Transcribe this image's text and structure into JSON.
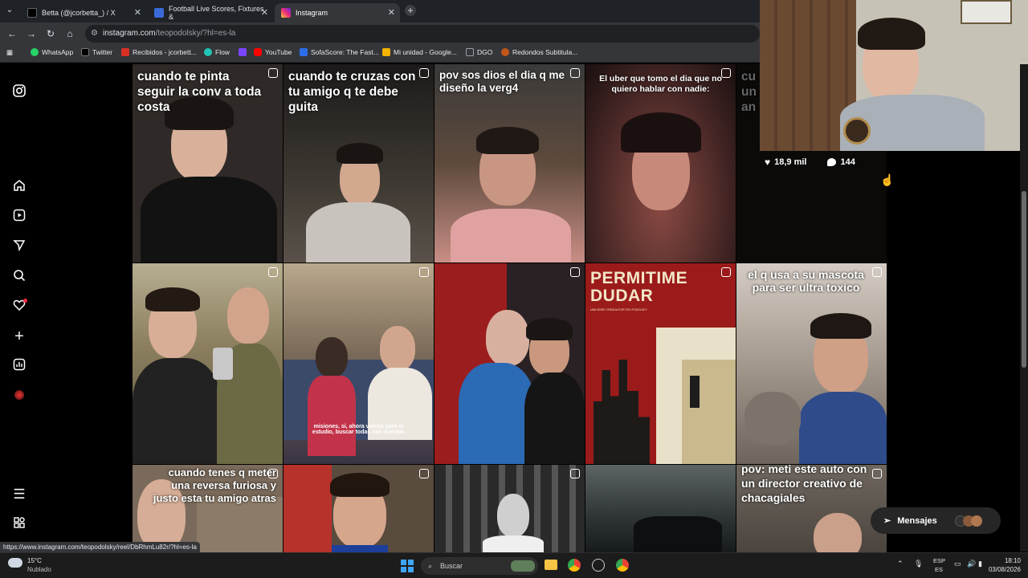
{
  "tabs": [
    {
      "title": "Betta (@jcorbetta_) / X",
      "favicon_color": "#000000",
      "active": false
    },
    {
      "title": "Football Live Scores, Fixtures &",
      "favicon_color": "#3a6bd8",
      "active": false
    },
    {
      "title": "Instagram",
      "favicon_color": "#e1306c",
      "active": true
    }
  ],
  "address": {
    "host": "instagram.com",
    "path": "/teopodolsky/?hl=es-la"
  },
  "bookmarks": [
    {
      "label": "WhatsApp",
      "color": "#25d366"
    },
    {
      "label": "Twitter",
      "color": "#000000"
    },
    {
      "label": "Recibidos - jcorbett...",
      "color": "#d93025"
    },
    {
      "label": "Flow",
      "color": "#21c4b5"
    },
    {
      "label": "",
      "color": "#7b44ff"
    },
    {
      "label": "YouTube",
      "color": "#ff0000"
    },
    {
      "label": "SofaScore: The Fast...",
      "color": "#2b6ee8"
    },
    {
      "label": "Mi unidad - Google...",
      "color": "#f4b400"
    },
    {
      "label": "DGO",
      "color": "#9aa0a6"
    },
    {
      "label": "Redondos Subtitula...",
      "color": "#c2571a"
    }
  ],
  "sidebar_icons": [
    "instagram-icon",
    "home-icon",
    "reels-icon",
    "explore-icon",
    "search-icon",
    "heart-icon",
    "create-icon",
    "dashboard-icon",
    "profile-avatar",
    "menu-icon",
    "more-apps-icon"
  ],
  "posts": [
    {
      "caption": "cuando te pinta seguir la conv a toda costa",
      "bg": "#2f2a27"
    },
    {
      "caption": "cuando te cruzas con tu amigo q te debe guita",
      "bg": "#3a3530"
    },
    {
      "caption": "pov sos dios el dia q me diseño la verg4",
      "bg": "#5e4a3c"
    },
    {
      "caption": "El uber que tomo el dia que no quiero hablar con nadie:",
      "bg": "#3b2120"
    },
    {
      "caption": "cu\nun\nan",
      "bg": "#1a1816"
    },
    {
      "caption": "",
      "bg": "#6d6240"
    },
    {
      "caption": "misiones, si, ahora vamos para el estudio, buscar todas mis mierdas",
      "bg": "#4a3f3a"
    },
    {
      "caption": "",
      "bg": "#2a2124"
    },
    {
      "caption": "PERMITIME DUDAR",
      "subtitle": "UNA SERIE CREADA POR TEO PODOLSKY",
      "bg": "#9b1b1b"
    },
    {
      "caption": "el q usa a su mascota para ser ultra toxico",
      "bg": "#8a7d72"
    },
    {
      "caption": "cuando tenes q meter una reversa furiosa y justo esta tu amigo atras",
      "bg": "#7a6a5b"
    },
    {
      "caption": "",
      "bg": "#5a4b3f"
    },
    {
      "caption": "",
      "bg": "#404040"
    },
    {
      "caption": "",
      "bg": "#2e3436"
    },
    {
      "caption": "pov: meti este auto con un director creativo de chacagiales",
      "bg": "#58504a"
    }
  ],
  "hover": {
    "likes": "18,9 mil",
    "comments": "144"
  },
  "messages_label": "Mensajes",
  "status_url": "https://www.instagram.com/teopodolsky/reel/DbRhmLu82r/?hl=es-la",
  "taskbar": {
    "weather_temp": "15°C",
    "weather_desc": "Nublado",
    "search_placeholder": "Buscar",
    "lang_top": "ESP",
    "lang_bottom": "ES",
    "time": "18:10",
    "date": "03/08/2026"
  }
}
